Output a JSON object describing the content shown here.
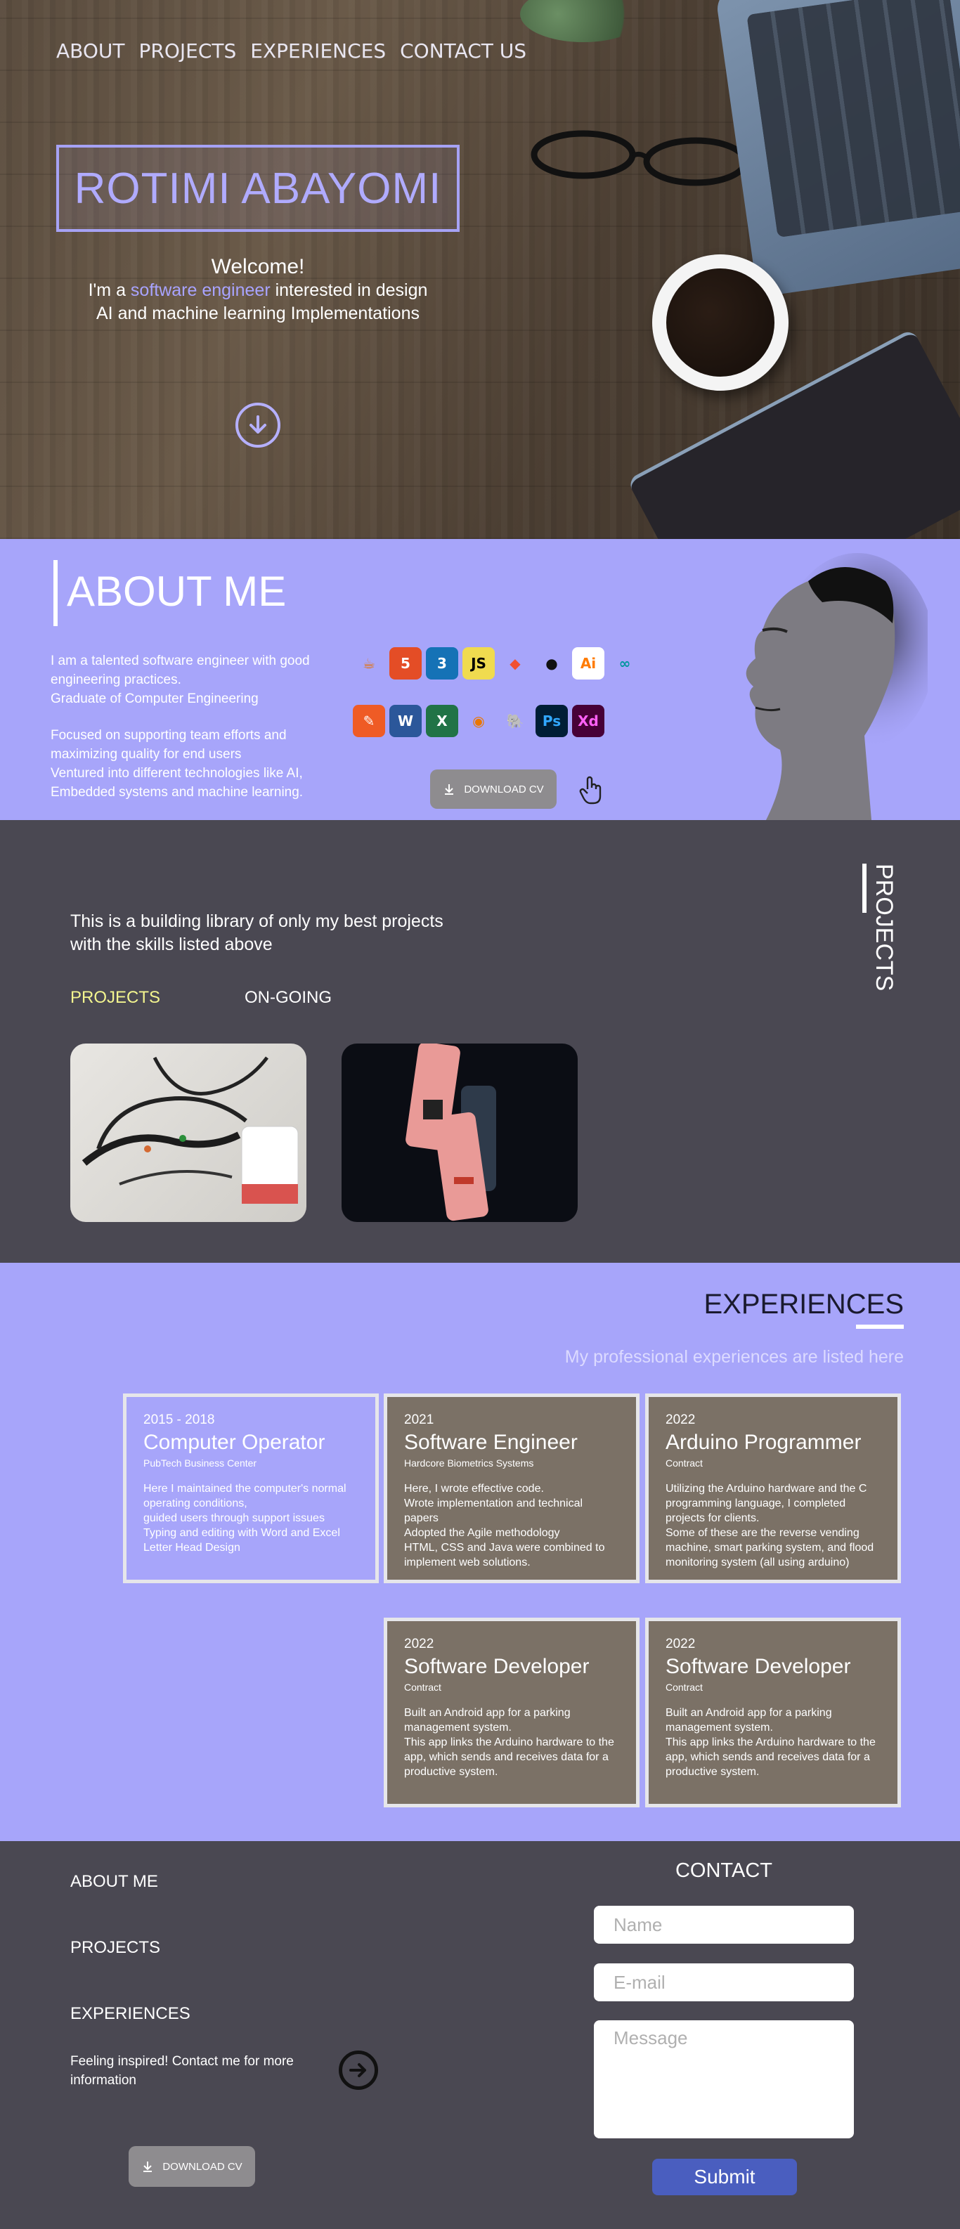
{
  "nav": {
    "about": "ABOUT",
    "projects": "PROJECTS",
    "experiences": "EXPERIENCES",
    "contact": "CONTACT US"
  },
  "hero": {
    "name": "ROTIMI ABAYOMI",
    "welcome": "Welcome!",
    "line2_pre": "I'm a ",
    "line2_highlight": "software engineer",
    "line2_post": " interested in design",
    "line3": "AI and machine learning Implementations",
    "accent": "#a8a3ff"
  },
  "about": {
    "title": "ABOUT ME",
    "para1": [
      "I am a talented software engineer with good engineering practices.",
      "Graduate of Computer Engineering"
    ],
    "para2": [
      "Focused on supporting team efforts and maximizing quality for end users",
      "Ventured into different technologies like AI, Embedded systems and machine learning."
    ],
    "skills_row1": [
      {
        "icon": "java-icon",
        "glyph": "☕",
        "color": "#e76f00",
        "bg": "transparent"
      },
      {
        "icon": "html5-icon",
        "glyph": "5",
        "color": "#ffffff",
        "bg": "#e44d26"
      },
      {
        "icon": "css3-icon",
        "glyph": "3",
        "color": "#ffffff",
        "bg": "#1572b6"
      },
      {
        "icon": "javascript-icon",
        "glyph": "JS",
        "color": "#000000",
        "bg": "#f0db4f"
      },
      {
        "icon": "git-icon",
        "glyph": "◆",
        "color": "#f05032",
        "bg": "transparent"
      },
      {
        "icon": "github-icon",
        "glyph": "●",
        "color": "#111111",
        "bg": "transparent"
      },
      {
        "icon": "illustrator-icon",
        "glyph": "Ai",
        "color": "#ff7c00",
        "bg": "#ffffff"
      },
      {
        "icon": "arduino-icon",
        "glyph": "∞",
        "color": "#00979d",
        "bg": "transparent"
      }
    ],
    "skills_row2": [
      {
        "icon": "postman-icon",
        "glyph": "✎",
        "color": "#ffffff",
        "bg": "#ef5b25"
      },
      {
        "icon": "word-icon",
        "glyph": "W",
        "color": "#ffffff",
        "bg": "#2b579a"
      },
      {
        "icon": "excel-icon",
        "glyph": "X",
        "color": "#ffffff",
        "bg": "#217346"
      },
      {
        "icon": "blender-icon",
        "glyph": "◉",
        "color": "#ea7600",
        "bg": "transparent"
      },
      {
        "icon": "postgresql-icon",
        "glyph": "🐘",
        "color": "#336791",
        "bg": "transparent"
      },
      {
        "icon": "photoshop-icon",
        "glyph": "Ps",
        "color": "#31a8ff",
        "bg": "#001e36"
      },
      {
        "icon": "xd-icon",
        "glyph": "Xd",
        "color": "#ff61f6",
        "bg": "#470137"
      }
    ],
    "download_cv": "DOWNLOAD CV"
  },
  "projects": {
    "label": "PROJECTS",
    "intro": [
      "This is a building library of only my best projects",
      "with the skills listed above"
    ],
    "tab_projects": "PROJECTS",
    "tab_ongoing": "ON-GOING",
    "active_tab_color": "#f3f58f"
  },
  "experiences": {
    "title": "EXPERIENCES",
    "subtitle": "My professional experiences are listed here",
    "cards": [
      {
        "year": "2015 - 2018",
        "role": "Computer Operator",
        "company": "PubTech Business Center",
        "desc": "Here I maintained the computer's normal operating conditions,\nguided users through support issues\nTyping and editing with Word and Excel\nLetter Head Design"
      },
      {
        "year": "2021",
        "role": "Software Engineer",
        "company": "Hardcore Biometrics Systems",
        "desc": "Here, I wrote effective code.\nWrote implementation and technical papers\nAdopted the Agile methodology\nHTML, CSS and Java were combined to implement web solutions."
      },
      {
        "year": "2022",
        "role": "Arduino Programmer",
        "company": "Contract",
        "desc": "Utilizing the Arduino hardware and the C programming language, I completed projects for clients.\nSome of these are the reverse vending machine, smart parking system, and flood monitoring system (all using arduino)"
      },
      {
        "year": "2022",
        "role": "Software Developer",
        "company": "Contract",
        "desc": "Built an Android app for a parking management system.\nThis app links the Arduino hardware to the app, which sends and receives data for a productive system."
      },
      {
        "year": "2022",
        "role": "Software Developer",
        "company": "Contract",
        "desc": "Built an Android app for a parking management system.\nThis app links the Arduino hardware to the app, which sends and receives data for a productive system."
      }
    ]
  },
  "footer": {
    "about": "ABOUT ME",
    "projects": "PROJECTS",
    "experiences": "EXPERIENCES",
    "inspire": "Feeling inspired! Contact me for more information",
    "download_cv": "DOWNLOAD CV",
    "contact_title": "CONTACT",
    "name_placeholder": "Name",
    "email_placeholder": "E-mail",
    "message_placeholder": "Message",
    "submit": "Submit"
  }
}
